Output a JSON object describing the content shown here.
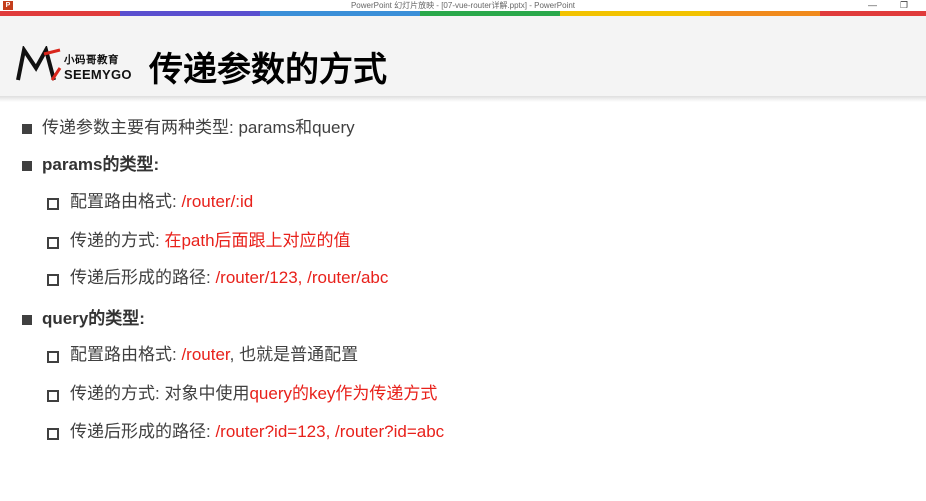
{
  "window": {
    "title": "PowerPoint 幻灯片放映 - [07-vue-router详解.pptx] - PowerPoint",
    "app_icon_letter": "P",
    "minimize_glyph": "—",
    "restore_glyph": "❐"
  },
  "colors": {
    "accent_red": "#e8211b",
    "text_gray": "#404040",
    "header_bg": "#f4f4f4",
    "stripe": [
      "#e03b3b",
      "#5a4fcf",
      "#3a8fd8",
      "#2aa84a",
      "#f2c200",
      "#f08a1c",
      "#e03b3b"
    ]
  },
  "logo": {
    "cn": "小码哥教育",
    "en": "SEEMYGO"
  },
  "slide": {
    "title": "传递参数的方式",
    "bullets": [
      {
        "level": 1,
        "text": "传递参数主要有两种类型: params和query",
        "highlight": ""
      },
      {
        "level": 1,
        "text": "params的类型:",
        "highlight": "",
        "bold": true
      },
      {
        "level": 2,
        "text": "配置路由格式: ",
        "highlight": "/router/:id"
      },
      {
        "level": 2,
        "text": "传递的方式: ",
        "highlight": "在path后面跟上对应的值"
      },
      {
        "level": 2,
        "text": "传递后形成的路径: ",
        "highlight": "/router/123, /router/abc"
      },
      {
        "level": 1,
        "text": "query的类型:",
        "highlight": "",
        "bold": true
      },
      {
        "level": 2,
        "text": "配置路由格式: ",
        "highlight": "/router",
        "suffix": ", 也就是普通配置"
      },
      {
        "level": 2,
        "text": "传递的方式: 对象中使用",
        "highlight": "query的key作为传递方式"
      },
      {
        "level": 2,
        "text": "传递后形成的路径: ",
        "highlight": "/router?id=123, /router?id=abc"
      }
    ]
  }
}
